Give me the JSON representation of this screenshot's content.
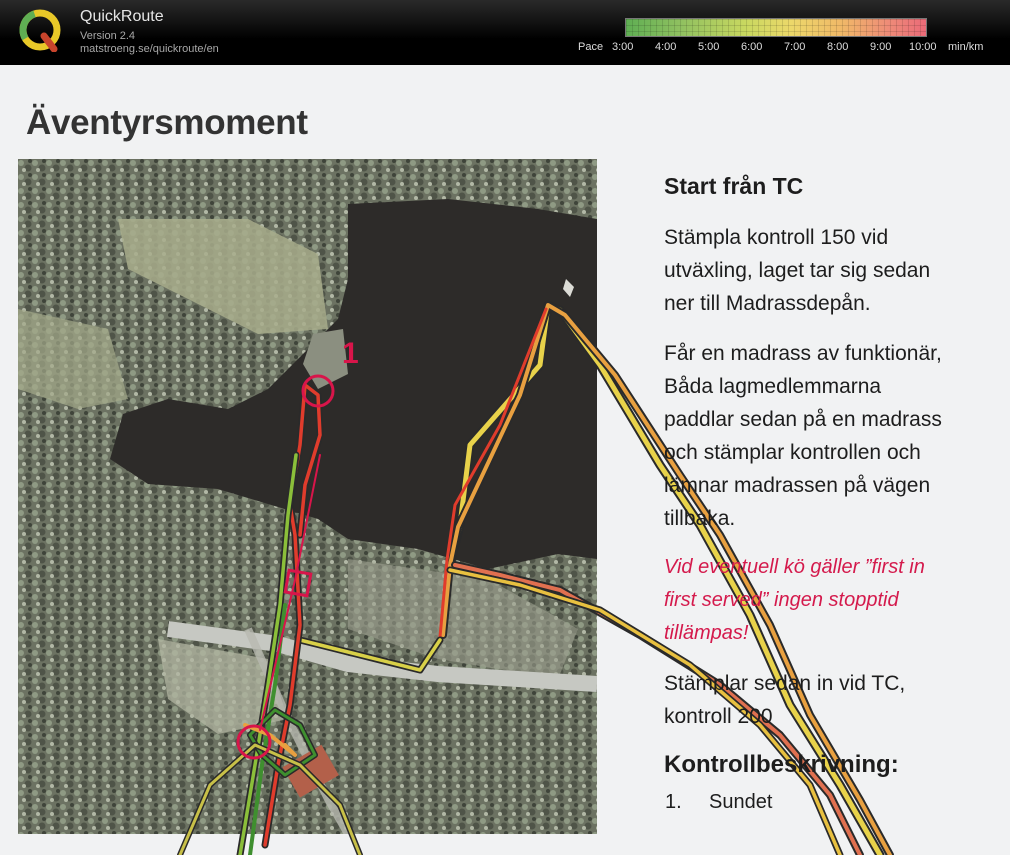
{
  "header": {
    "app_name": "QuickRoute",
    "version": "Version 2.4",
    "url": "matstroeng.se/quickroute/en"
  },
  "pace_scale": {
    "label": "Pace",
    "ticks": [
      "3:00",
      "4:00",
      "5:00",
      "6:00",
      "7:00",
      "8:00",
      "9:00",
      "10:00"
    ],
    "unit": "min/km"
  },
  "map_document": {
    "title": "Äventyrsmoment",
    "control_number": "1",
    "start_heading": "Start från TC",
    "paragraph1": [
      "Stämpla kontroll 150 vid",
      "utväxling, laget tar sig sedan",
      "ner till Madrassdepån."
    ],
    "paragraph2": [
      "Får en madrass av funktionär,",
      "Båda lagmedlemmarna",
      "paddlar sedan på en madrass",
      "och stämplar kontrollen och",
      "lämnar madrassen på vägen",
      "tillbaka."
    ],
    "red_note": [
      "Vid eventuell kö gäller ”first in",
      "first served” ingen stopptid",
      "tillämpas!"
    ],
    "paragraph3": [
      "Stämplar sedan in vid TC,",
      "kontroll 200"
    ],
    "description_heading": "Kontrollbeskrivning:",
    "description_item": {
      "number": "1.",
      "name": "Sundet"
    }
  },
  "colors": {
    "route_red": "#e03c2c",
    "route_yellow": "#e8d24a",
    "route_green": "#3f8f2f",
    "control_magenta": "#d8154a"
  }
}
